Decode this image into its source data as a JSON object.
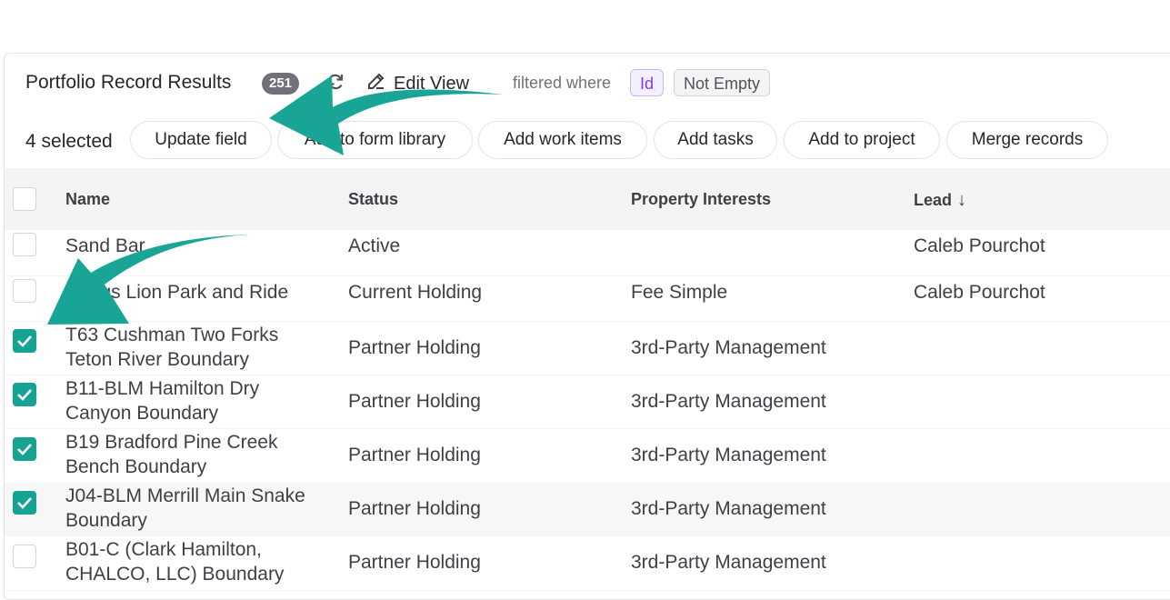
{
  "header": {
    "title": "Portfolio Record Results",
    "count": "251",
    "edit_view_label": "Edit View",
    "filtered_where": "filtered where",
    "filter_field": "Id",
    "filter_condition": "Not Empty"
  },
  "actions": {
    "selected_label": "4 selected",
    "buttons": [
      "Update field",
      "Add to form library",
      "Add work items",
      "Add tasks",
      "Add to project",
      "Merge records"
    ]
  },
  "table": {
    "columns": [
      "Name",
      "Status",
      "Property Interests",
      "Lead"
    ],
    "sort_indicator": "↓",
    "rows": [
      {
        "checked": false,
        "name": "Sand Bar",
        "status": "Active",
        "property": "",
        "lead": "Caleb Pourchot"
      },
      {
        "checked": false,
        "name": "Driggs Lion Park and Ride",
        "status": "Current Holding",
        "property": "Fee Simple",
        "lead": "Caleb Pourchot"
      },
      {
        "checked": true,
        "name": "T63 Cushman Two Forks Teton River Boundary",
        "status": "Partner Holding",
        "property": "3rd-Party Management",
        "lead": ""
      },
      {
        "checked": true,
        "name": "B11-BLM Hamilton Dry Canyon Boundary",
        "status": "Partner Holding",
        "property": "3rd-Party Management",
        "lead": ""
      },
      {
        "checked": true,
        "name": "B19 Bradford Pine Creek Bench Boundary",
        "status": "Partner Holding",
        "property": "3rd-Party Management",
        "lead": ""
      },
      {
        "checked": true,
        "name": "J04-BLM Merrill Main Snake Boundary",
        "status": "Partner Holding",
        "property": "3rd-Party Management",
        "lead": ""
      },
      {
        "checked": false,
        "name": "B01-C (Clark Hamilton, CHALCO, LLC) Boundary",
        "status": "Partner Holding",
        "property": "3rd-Party Management",
        "lead": ""
      }
    ]
  },
  "colors": {
    "accent": "#16a394",
    "arrow": "#18a596",
    "chip_id": "#7c3aed",
    "badge": "#71717a"
  },
  "icons": [
    "refresh-icon",
    "edit-icon",
    "check-icon",
    "sort-down-arrow-icon",
    "annotation-arrow-icon"
  ]
}
